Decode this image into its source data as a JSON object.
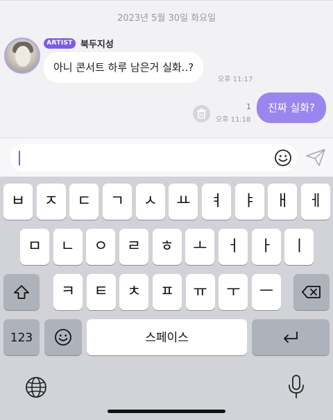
{
  "chat": {
    "date_divider": "2023년 5월 30일 화요일",
    "incoming": {
      "badge": "ARTIST",
      "sender": "북두지성",
      "text": "아니 콘서트 하루 남은거 실화..?",
      "time": "오후 11:17"
    },
    "outgoing": {
      "unread_count": "1",
      "time": "오후 11:18",
      "text": "진짜 실화?"
    }
  },
  "input": {
    "value": "",
    "emoji_icon": "smiley-icon",
    "send_icon": "paper-plane-icon"
  },
  "keyboard": {
    "row1": [
      "ㅂ",
      "ㅈ",
      "ㄷ",
      "ㄱ",
      "ㅅ",
      "ㅛ",
      "ㅕ",
      "ㅑ",
      "ㅐ",
      "ㅔ"
    ],
    "row2": [
      "ㅁ",
      "ㄴ",
      "ㅇ",
      "ㄹ",
      "ㅎ",
      "ㅗ",
      "ㅓ",
      "ㅏ",
      "ㅣ"
    ],
    "row3": [
      "ㅋ",
      "ㅌ",
      "ㅊ",
      "ㅍ",
      "ㅠ",
      "ㅜ",
      "ㅡ"
    ],
    "numbers_label": "123",
    "space_label": "스페이스",
    "icons": {
      "shift": "shift-arrow-icon",
      "backspace": "backspace-icon",
      "emoji": "emoji-icon",
      "return": "return-icon",
      "globe": "globe-icon",
      "mic": "microphone-icon"
    }
  },
  "colors": {
    "accent": "#7a5ce8",
    "outgoing_bubble": "#9b85ee",
    "keyboard_bg": "#d1d3d9",
    "dark_key": "#aeb2bb"
  }
}
